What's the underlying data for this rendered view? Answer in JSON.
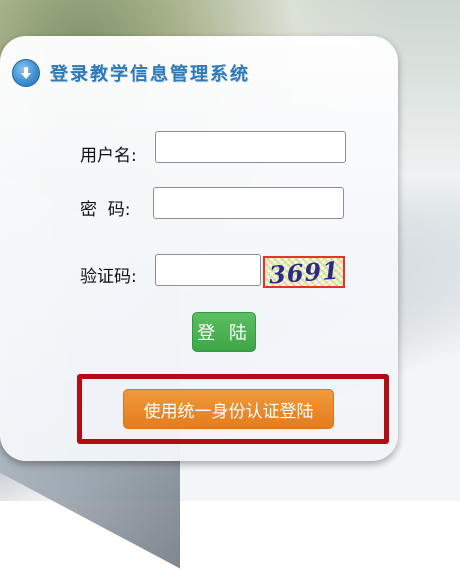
{
  "header": {
    "title": "登录教学信息管理系统",
    "icon": "download-arrow-icon"
  },
  "form": {
    "username_label": "用户名:",
    "username_value": "",
    "password_label": "密  码:",
    "password_value": "",
    "captcha_label": "验证码:",
    "captcha_value": "",
    "captcha_image_text": "3691"
  },
  "buttons": {
    "login_label": "登 陆",
    "sso_label": "使用统一身份认证登陆"
  },
  "colors": {
    "title": "#2f79b9",
    "login_button": "#46aa4e",
    "sso_button": "#e98a2b",
    "highlight_border": "#b30c12"
  }
}
